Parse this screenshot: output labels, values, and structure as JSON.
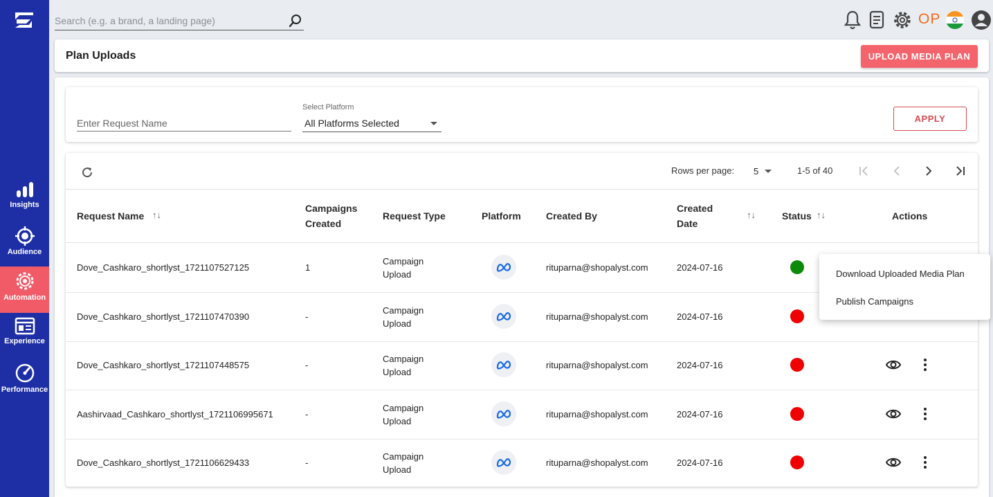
{
  "search": {
    "placeholder": "Search (e.g. a brand, a landing page)"
  },
  "topbar": {
    "initials": "OP"
  },
  "sidebar": {
    "items": [
      {
        "label": "Insights",
        "icon": "bar-chart-icon"
      },
      {
        "label": "Audience",
        "icon": "target-icon"
      },
      {
        "label": "Automation",
        "icon": "gear-icon"
      },
      {
        "label": "Experience",
        "icon": "browser-icon"
      },
      {
        "label": "Performance",
        "icon": "gauge-icon"
      }
    ]
  },
  "header": {
    "title": "Plan Uploads",
    "upload_label": "UPLOAD MEDIA PLAN"
  },
  "filters": {
    "request_placeholder": "Enter Request Name",
    "platform_label": "Select Platform",
    "platform_value": "All Platforms Selected",
    "apply_label": "APPLY"
  },
  "pagination": {
    "rows_label": "Rows per page:",
    "rows_value": "5",
    "range": "1-5 of 40"
  },
  "table": {
    "headers": {
      "request_name": "Request Name",
      "campaigns_line1": "Campaigns",
      "campaigns_line2": "Created",
      "request_type": "Request Type",
      "platform": "Platform",
      "created_by": "Created By",
      "created_date_line1": "Created",
      "created_date_line2": "Date",
      "status": "Status",
      "actions": "Actions"
    },
    "rows": [
      {
        "name": "Dove_Cashkaro_shortlyst_1721107527125",
        "campaigns": "1",
        "type1": "Campaign",
        "type2": "Upload",
        "created_by": "rituparna@shopalyst.com",
        "date": "2024-07-16",
        "status_color": "#0b8a0b"
      },
      {
        "name": "Dove_Cashkaro_shortlyst_1721107470390",
        "campaigns": "-",
        "type1": "Campaign",
        "type2": "Upload",
        "created_by": "rituparna@shopalyst.com",
        "date": "2024-07-16",
        "status_color": "#f00000"
      },
      {
        "name": "Dove_Cashkaro_shortlyst_1721107448575",
        "campaigns": "-",
        "type1": "Campaign",
        "type2": "Upload",
        "created_by": "rituparna@shopalyst.com",
        "date": "2024-07-16",
        "status_color": "#f00000"
      },
      {
        "name": "Aashirvaad_Cashkaro_shortlyst_1721106995671",
        "campaigns": "-",
        "type1": "Campaign",
        "type2": "Upload",
        "created_by": "rituparna@shopalyst.com",
        "date": "2024-07-16",
        "status_color": "#f00000"
      },
      {
        "name": "Dove_Cashkaro_shortlyst_1721106629433",
        "campaigns": "-",
        "type1": "Campaign",
        "type2": "Upload",
        "created_by": "rituparna@shopalyst.com",
        "date": "2024-07-16",
        "status_color": "#f00000"
      }
    ]
  },
  "context_menu": {
    "download": "Download Uploaded Media Plan",
    "publish": "Publish Campaigns"
  },
  "colors": {
    "sidebar": "#1e2fa6",
    "accent": "#f4646c",
    "active_nav": "#f15b67"
  }
}
